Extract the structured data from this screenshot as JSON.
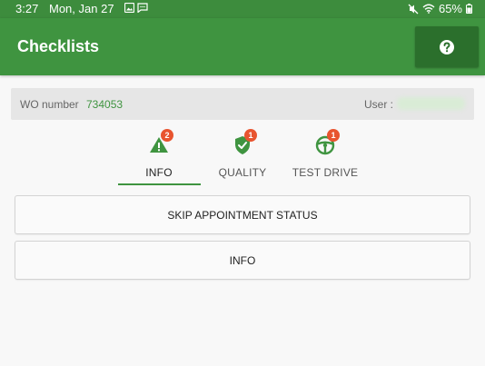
{
  "status_bar": {
    "time": "3:27",
    "date": "Mon, Jan 27",
    "battery": "65%"
  },
  "app_bar": {
    "title": "Checklists",
    "help_icon": "question-circle-icon"
  },
  "work_order": {
    "label": "WO number",
    "value": "734053",
    "user_label": "User :"
  },
  "tabs": [
    {
      "label": "INFO",
      "badge": "2",
      "icon": "warning-triangle-icon",
      "active": true
    },
    {
      "label": "QUALITY",
      "badge": "1",
      "icon": "shield-check-icon",
      "active": false
    },
    {
      "label": "TEST DRIVE",
      "badge": "1",
      "icon": "steering-wheel-icon",
      "active": false
    }
  ],
  "items": [
    {
      "label": "SKIP APPOINTMENT STATUS"
    },
    {
      "label": "INFO"
    }
  ],
  "colors": {
    "primary": "#3f9440",
    "primary_dark": "#2b6f2c",
    "badge": "#e8542f"
  }
}
